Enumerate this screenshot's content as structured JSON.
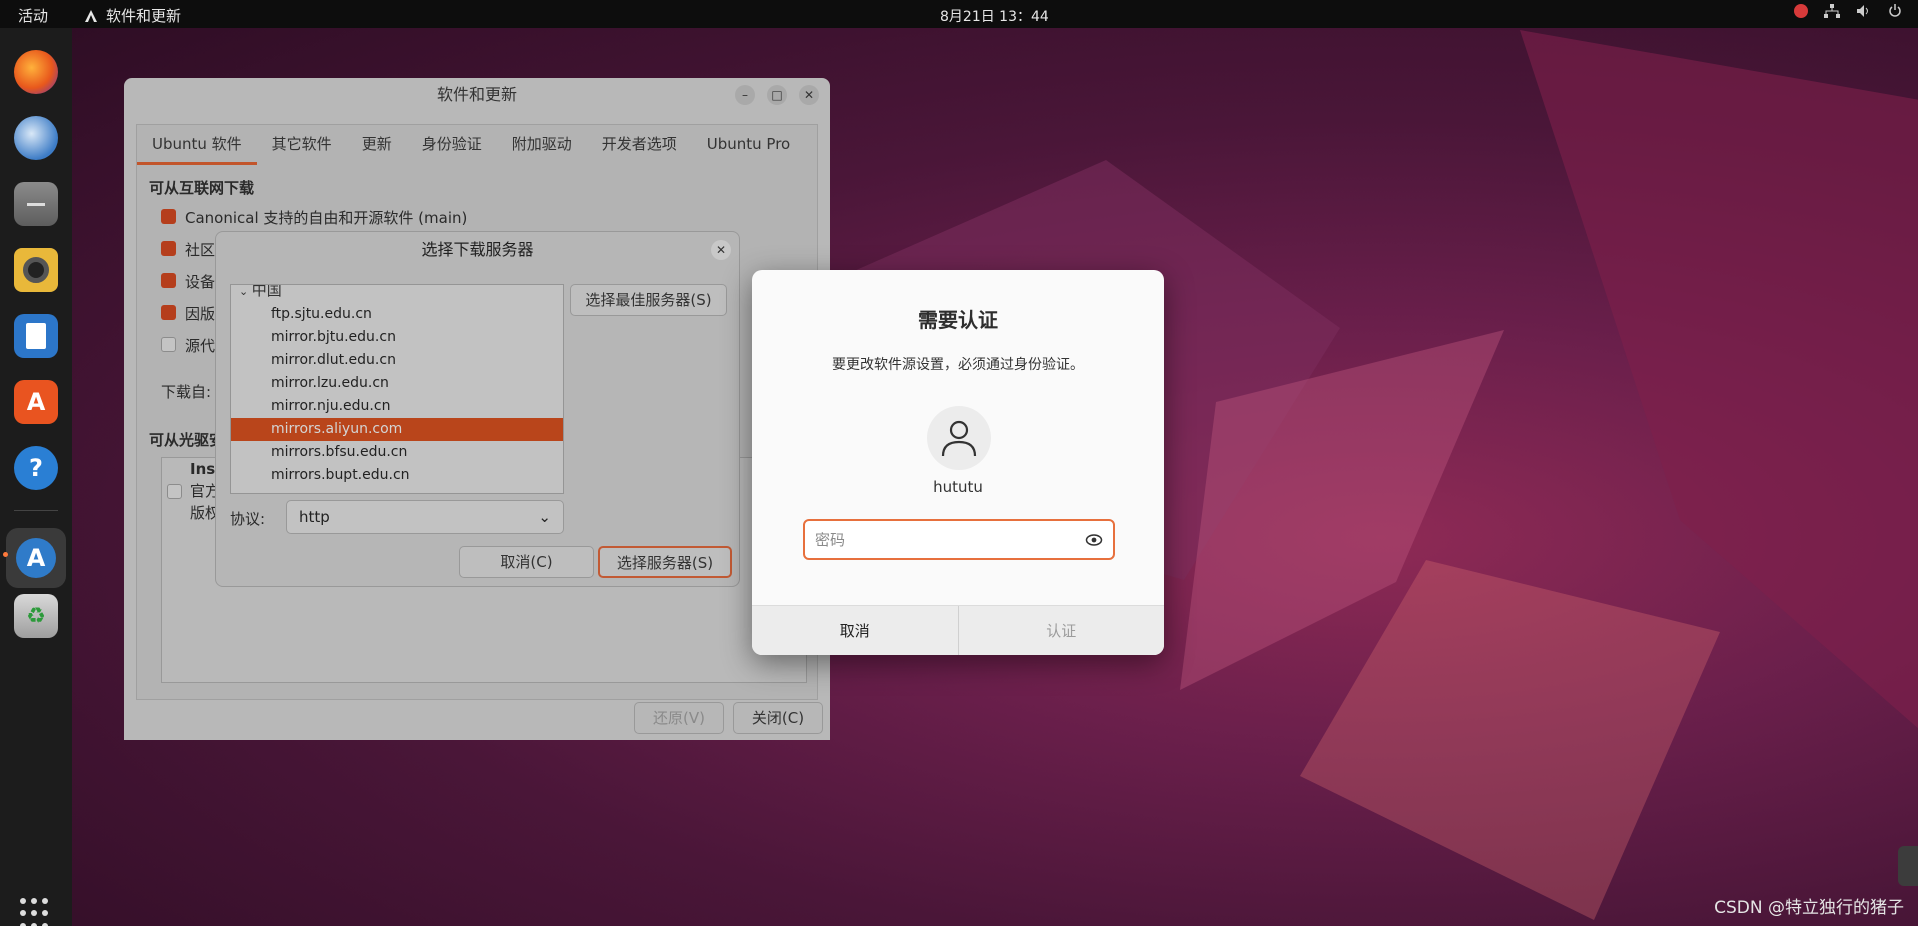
{
  "topbar": {
    "activities": "活动",
    "app_name": "软件和更新",
    "clock": "8月21日  13：44"
  },
  "dock": {
    "icons": [
      "firefox-icon",
      "thunderbird-icon",
      "files-icon",
      "rhythmbox-icon",
      "libreoffice-writer-icon",
      "app-center-icon",
      "help-icon",
      "software-updater-icon",
      "trash-icon"
    ]
  },
  "main_window": {
    "title": "软件和更新",
    "tabs": [
      "Ubuntu 软件",
      "其它软件",
      "更新",
      "身份验证",
      "附加驱动",
      "开发者选项",
      "Ubuntu Pro"
    ],
    "section_internet": "可从互联网下载",
    "options": [
      "Canonical 支持的自由和开源软件 (main)",
      "社区",
      "设备",
      "因版",
      "源代"
    ],
    "download_from": "下载自:",
    "section_cd": "可从光驱安",
    "cd_line1": "Inst",
    "cd_line2": "官方",
    "cd_line3": "版权",
    "revert_button": "还原(V)",
    "close_button": "关闭(C)"
  },
  "mirror_dialog": {
    "title": "选择下载服务器",
    "group": "中国",
    "mirrors": [
      "ftp.sjtu.edu.cn",
      "mirror.bjtu.edu.cn",
      "mirror.dlut.edu.cn",
      "mirror.lzu.edu.cn",
      "mirror.nju.edu.cn",
      "mirrors.aliyun.com",
      "mirrors.bfsu.edu.cn",
      "mirrors.bupt.edu.cn"
    ],
    "selected_mirror": "mirrors.aliyun.com",
    "best_server_button": "选择最佳服务器(S)",
    "protocol_label": "协议:",
    "protocol_value": "http",
    "cancel_button": "取消(C)",
    "select_button": "选择服务器(S)"
  },
  "auth_dialog": {
    "heading": "需要认证",
    "message": "要更改软件源设置，必须通过身份验证。",
    "username": "hututu",
    "password_placeholder": "密码",
    "cancel_button": "取消",
    "confirm_button": "认证"
  },
  "watermark": "CSDN @特立独行的猪子",
  "colors": {
    "accent": "#E95420",
    "selection": "#B9451B",
    "topbar": "#0D0D0D"
  }
}
